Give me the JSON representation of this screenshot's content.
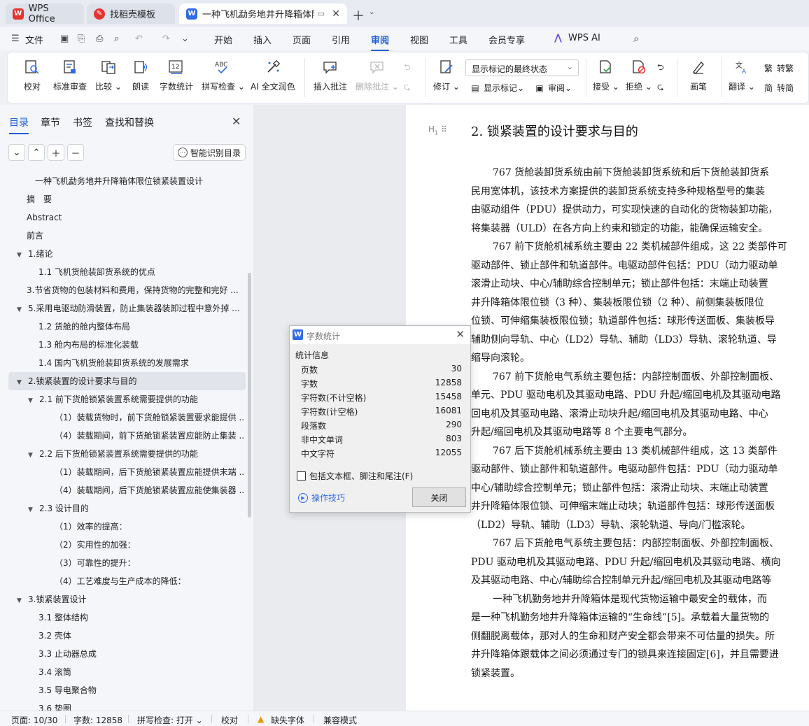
{
  "tabs": [
    {
      "label": "WPS Office",
      "icon": "wps-icon"
    },
    {
      "label": "找稻壳模板",
      "icon": "docer-icon"
    },
    {
      "label": "一种飞机勐务地井升降箱体限",
      "icon": "writer-icon"
    }
  ],
  "menu": {
    "file": "文件",
    "items": [
      "开始",
      "插入",
      "页面",
      "引用",
      "审阅",
      "视图",
      "工具",
      "会员专享"
    ],
    "active": "审阅",
    "ai": "WPS AI"
  },
  "ribbon": {
    "proofread": "校对",
    "standard_review": "标准审查",
    "compare": "比较",
    "read_aloud": "朗读",
    "word_count": "字数统计",
    "spell_check": "拼写检查",
    "ai_polish": "AI 全文润色",
    "insert_comment": "插入批注",
    "delete_comment": "删除批注",
    "track_select": "显示标记的最终状态",
    "revise": "修订",
    "show_marks": "显示标记",
    "review": "审阅",
    "accept": "接受",
    "reject": "拒绝",
    "pen": "画笔",
    "translate": "翻译",
    "to_traditional": "转繁",
    "to_simplified": "转简"
  },
  "nav": {
    "tabs": [
      "目录",
      "章节",
      "书签",
      "查找和替换"
    ],
    "smart_button": "智能识别目录",
    "toc": [
      {
        "text": "一种飞机勐务地井升降箱体限位锁紧装置设计",
        "level": 0,
        "arrow": ""
      },
      {
        "text": "摘　要",
        "level": 1,
        "arrow": ""
      },
      {
        "text": "Abstract",
        "level": 1,
        "arrow": ""
      },
      {
        "text": "前言",
        "level": 1,
        "arrow": ""
      },
      {
        "text": "1.绪论",
        "level": 1,
        "arrow": "▼"
      },
      {
        "text": "1.1 飞机货舱装卸货系统的优点",
        "level": 2,
        "arrow": ""
      },
      {
        "text": "3.节省货物的包装材料和费用，保持货物的完整和完好 ...",
        "level": 1,
        "arrow": ""
      },
      {
        "text": "5.采用电驱动防滑装置，防止集装器装卸过程中意外掉 ...",
        "level": 1,
        "arrow": "▼"
      },
      {
        "text": "1.2 货舱的舱内整体布局",
        "level": 2,
        "arrow": ""
      },
      {
        "text": "1.3 舱内布局的标准化装载",
        "level": 2,
        "arrow": ""
      },
      {
        "text": "1.4 国内飞机货舱装卸货系统的发展需求",
        "level": 2,
        "arrow": ""
      },
      {
        "text": "2.锁紧装置的设计要求与目的",
        "level": 1,
        "arrow": "▼",
        "selected": true
      },
      {
        "text": "2.1 前下货舱锁紧装置系统需要提供的功能",
        "level": 2,
        "arrow": "▼"
      },
      {
        "text": "（1）装载货物时，前下货舱锁紧装置要求能提供 ...",
        "level": 3,
        "arrow": ""
      },
      {
        "text": "（4）装载期间，前下货舱锁紧装置应能防止集装 ...",
        "level": 3,
        "arrow": ""
      },
      {
        "text": "2.2 后下货舱锁紧装置系统需要提供的功能",
        "level": 2,
        "arrow": "▼"
      },
      {
        "text": "（1）装载期间，后下货舱锁紧装置应能提供末端 ...",
        "level": 3,
        "arrow": ""
      },
      {
        "text": "（4）装载期间，后下货舱锁紧装置应能使集装器 ...",
        "level": 3,
        "arrow": ""
      },
      {
        "text": "2.3 设计目的",
        "level": 2,
        "arrow": "▼"
      },
      {
        "text": "（1）效率的提高：",
        "level": 3,
        "arrow": ""
      },
      {
        "text": "（2）实用性的加强：",
        "level": 3,
        "arrow": ""
      },
      {
        "text": "（3）可靠性的提升：",
        "level": 3,
        "arrow": ""
      },
      {
        "text": "（4）工艺难度与生产成本的降低：",
        "level": 3,
        "arrow": ""
      },
      {
        "text": "3.锁紧装置设计",
        "level": 1,
        "arrow": "▼"
      },
      {
        "text": "3.1 整体结构",
        "level": 2,
        "arrow": ""
      },
      {
        "text": "3.2 壳体",
        "level": 2,
        "arrow": ""
      },
      {
        "text": "3.3 止动器总成",
        "level": 2,
        "arrow": ""
      },
      {
        "text": "3.4 滚筒",
        "level": 2,
        "arrow": ""
      },
      {
        "text": "3.5 导电聚合物",
        "level": 2,
        "arrow": ""
      },
      {
        "text": "3.6 垫圈",
        "level": 2,
        "arrow": ""
      }
    ]
  },
  "document": {
    "heading_marker": "H",
    "title": "2. 锁紧装置的设计要求与目的",
    "lines": [
      {
        "text": "767 货舱装卸货系统由前下货舱装卸货系统和后下货舱装卸货系",
        "indent": true
      },
      {
        "text": "民用宽体机，该技术方案提供的装卸货系统支持多种规格型号的集装",
        "indent": false
      },
      {
        "text": "由驱动组件（PDU）提供动力，可实现快速的自动化的货物装卸功能，",
        "indent": false
      },
      {
        "text": "将集装器（ULD）在各方向上约束和锁定的功能，能确保运输安全。",
        "indent": false
      },
      {
        "text": "767 前下货舱机械系统主要由 22 类机械部件组成，这 22 类部件可",
        "indent": true
      },
      {
        "text": "驱动部件、锁止部件和轨道部件。电驱动部件包括：PDU（动力驱动单",
        "indent": false
      },
      {
        "text": "滚滑止动块、中心/辅助综合控制单元；锁止部件包括：末端止动装置",
        "indent": false
      },
      {
        "text": "井升降箱体限位锁（3 种）、集装板限位锁（2 种）、前侧集装板限位",
        "indent": false
      },
      {
        "text": "位锁、可伸缩集装板限位锁；轨道部件包括：球形传送面板、集装板导",
        "indent": false
      },
      {
        "text": "辅助侧向导轨、中心（LD2）导轨、辅助（LD3）导轨、滚轮轨道、导",
        "indent": false
      },
      {
        "text": "缩导向滚轮。",
        "indent": false
      },
      {
        "text": "767 前下货舱电气系统主要包括：内部控制面板、外部控制面板、",
        "indent": true
      },
      {
        "text": "单元、PDU 驱动电机及其驱动电路、PDU 升起/缩回电机及其驱动电路",
        "indent": false
      },
      {
        "text": "回电机及其驱动电路、滚滑止动块升起/缩回电机及其驱动电路、中心",
        "indent": false
      },
      {
        "text": "升起/缩回电机及其驱动电路等 8 个主要电气部分。",
        "indent": false
      },
      {
        "text": "767 后下货舱机械系统主要由 13 类机械部件组成，这 13 类部件",
        "indent": true
      },
      {
        "text": "驱动部件、锁止部件和轨道部件。电驱动部件包括：PDU（动力驱动单",
        "indent": false
      },
      {
        "text": "中心/辅助综合控制单元；锁止部件包括：滚滑止动块、末端止动装置",
        "indent": false
      },
      {
        "text": "井升降箱体限位锁、可伸缩末端止动块；轨道部件包括：球形传送面板",
        "indent": false
      },
      {
        "text": "（LD2）导轨、辅助（LD3）导轨、滚轮轨道、导向/门槛滚轮。",
        "indent": false
      },
      {
        "text": "767 后下货舱电气系统主要包括：内部控制面板、外部控制面板、",
        "indent": true
      },
      {
        "text": "PDU 驱动电机及其驱动电路、PDU 升起/缩回电机及其驱动电路、横向",
        "indent": false
      },
      {
        "text": "及其驱动电路、中心/辅助综合控制单元升起/缩回电机及其驱动电路等",
        "indent": false
      },
      {
        "text": "一种飞机勤务地井升降箱体是现代货物运输中最安全的载体，而",
        "indent": true
      },
      {
        "text": "是一种飞机勤务地井升降箱体运输的“生命线”[5]。承载着大量货物的",
        "indent": false
      },
      {
        "text": "侧翻脱离载体，那对人的生命和财产安全都会带来不可估量的损失。所",
        "indent": false
      },
      {
        "text": "井升降箱体跟载体之间必须通过专门的锁具来连接固定[6]，并且需要进",
        "indent": false
      },
      {
        "text": "锁紧装置。",
        "indent": false
      }
    ]
  },
  "dialog": {
    "title": "字数统计",
    "section": "统计信息",
    "stats": [
      {
        "label": "页数",
        "value": "30"
      },
      {
        "label": "字数",
        "value": "12858"
      },
      {
        "label": "字符数(不计空格)",
        "value": "15458"
      },
      {
        "label": "字符数(计空格)",
        "value": "16081"
      },
      {
        "label": "段落数",
        "value": "290"
      },
      {
        "label": "非中文单词",
        "value": "803"
      },
      {
        "label": "中文字符",
        "value": "12055"
      }
    ],
    "include_label": "包括文本框、脚注和尾注(F)",
    "tips": "操作技巧",
    "close": "关闭"
  },
  "status": {
    "page": "页面: 10/30",
    "words": "字数: 12858",
    "spell": "拼写检查: 打开",
    "proofread": "校对",
    "missing_font": "缺失字体",
    "compat": "兼容模式"
  }
}
